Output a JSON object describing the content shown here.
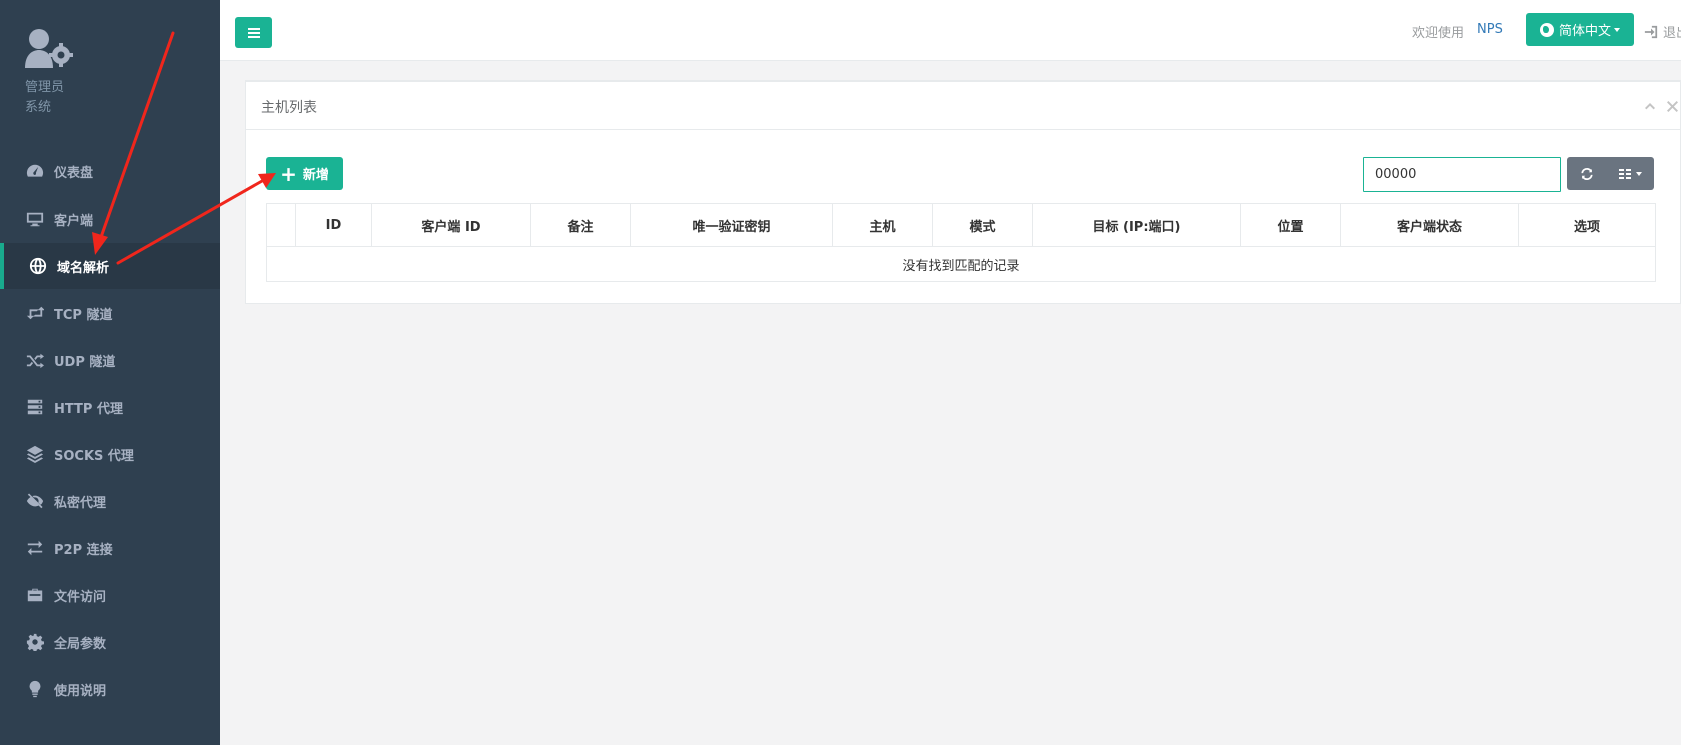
{
  "sidebar": {
    "profile": {
      "role": "管理员",
      "system": "系统",
      "avatar_icon": "user-cog-icon"
    },
    "items": [
      {
        "label": "仪表盘",
        "icon": "dashboard-icon",
        "active": false
      },
      {
        "label": "客户端",
        "icon": "monitor-icon",
        "active": false
      },
      {
        "label": "域名解析",
        "icon": "globe-icon",
        "active": true
      },
      {
        "label": "TCP 隧道",
        "icon": "retweet-icon",
        "active": false
      },
      {
        "label": "UDP 隧道",
        "icon": "shuffle-icon",
        "active": false
      },
      {
        "label": "HTTP 代理",
        "icon": "server-icon",
        "active": false
      },
      {
        "label": "SOCKS 代理",
        "icon": "layers-icon",
        "active": false
      },
      {
        "label": "私密代理",
        "icon": "eye-slash-icon",
        "active": false
      },
      {
        "label": "P2P 连接",
        "icon": "exchange-icon",
        "active": false
      },
      {
        "label": "文件访问",
        "icon": "briefcase-icon",
        "active": false
      },
      {
        "label": "全局参数",
        "icon": "gear-icon",
        "active": false
      },
      {
        "label": "使用说明",
        "icon": "lightbulb-icon",
        "active": false
      }
    ]
  },
  "topbar": {
    "welcome": "欢迎使用",
    "brand": "NPS",
    "language": "简体中文",
    "logout": "退出"
  },
  "panel": {
    "title": "主机列表",
    "add_label": "新增",
    "search_value": "00000",
    "columns": [
      "",
      "ID",
      "客户端 ID",
      "备注",
      "唯一验证密钥",
      "主机",
      "模式",
      "目标 (IP:端口)",
      "位置",
      "客户端状态",
      "选项"
    ],
    "empty_message": "没有找到匹配的记录"
  },
  "colors": {
    "accent": "#1ab394",
    "sidebar_bg": "#2f4050",
    "annotation_arrow": "#f0261c"
  }
}
